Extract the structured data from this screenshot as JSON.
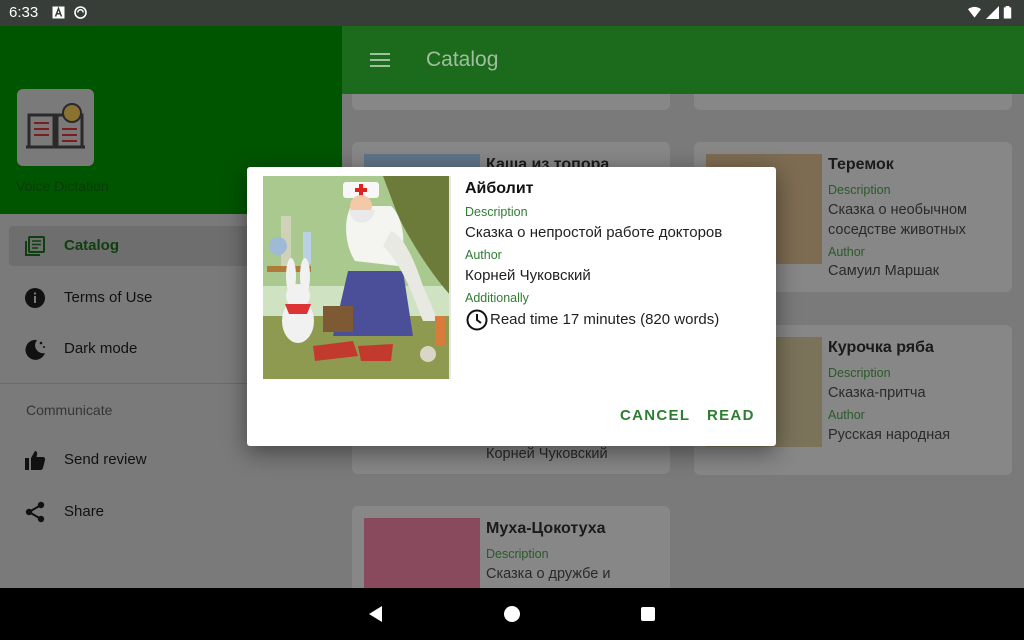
{
  "status_bar": {
    "time": "6:33"
  },
  "app": {
    "name": "Voice Dictation",
    "toolbar_title": "Catalog"
  },
  "drawer": {
    "items": [
      {
        "label": "Catalog",
        "icon": "catalog-icon",
        "active": true
      },
      {
        "label": "Terms of Use",
        "icon": "info-icon"
      },
      {
        "label": "Dark mode",
        "icon": "moon-icon"
      }
    ],
    "section": "Communicate",
    "communicate_items": [
      {
        "label": "Send review",
        "icon": "thumbs-up-icon"
      },
      {
        "label": "Share",
        "icon": "share-icon"
      }
    ]
  },
  "catalog": {
    "description_label": "Description",
    "author_label": "Author",
    "cards": [
      {
        "title": "Каша из топора",
        "author": "Корней Чуковский"
      },
      {
        "title": "Теремок",
        "description": "Сказка о необычном соседстве животных",
        "author": "Самуил Маршак"
      },
      {
        "title": "Курочка ряба",
        "description": "Сказка-притча",
        "author": "Русская народная"
      },
      {
        "title": "Муха-Цокотуха",
        "description": "Сказка о дружбе и"
      }
    ]
  },
  "dialog": {
    "title": "Айболит",
    "description_label": "Description",
    "description": "Сказка о непростой работе докторов",
    "author_label": "Author",
    "author": "Корней Чуковский",
    "additionally_label": "Additionally",
    "read_time": "Read time 17 minutes (820 words)",
    "cancel_label": "CANCEL",
    "read_label": "READ"
  },
  "colors": {
    "primary": "#1b7a1b",
    "primary_dark": "#006400",
    "accent_text": "#2e7d32"
  }
}
